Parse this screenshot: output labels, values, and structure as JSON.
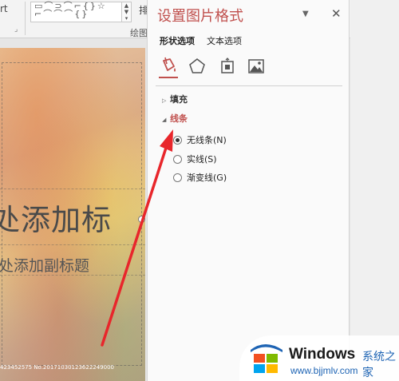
{
  "ribbon": {
    "left_fragment": "rt",
    "shape_row_1": "▭⌒⊃⌒⌐{}☆",
    "shape_row_2": "⌐⌒⌒⌒{}",
    "group_label": "绘图",
    "group_char": "排"
  },
  "slide": {
    "title": "处添加标",
    "subtitle": "处添加副标题",
    "watermark": "423452575 No.20171030123622249000"
  },
  "pane": {
    "title": "设置图片格式",
    "tabs": [
      "形状选项",
      "文本选项"
    ],
    "active_tab": "形状选项",
    "category_icons": [
      "fill-bucket-icon",
      "pentagon-effects-icon",
      "size-properties-icon",
      "picture-icon"
    ],
    "sections": {
      "fill": {
        "label": "填充",
        "expanded": false
      },
      "line": {
        "label": "线条",
        "expanded": true
      }
    },
    "line_options": [
      {
        "label": "无线条(N)",
        "checked": true
      },
      {
        "label": "实线(S)",
        "checked": false
      },
      {
        "label": "渐变线(G)",
        "checked": false
      }
    ],
    "accent_color": "#c0504d"
  },
  "watermark_badge": {
    "brand": "Windows",
    "brand_cn": "系统之家",
    "url": "www.bjjmlv.com",
    "logo_colors": [
      "#f25022",
      "#7fba00",
      "#00a4ef",
      "#ffb900"
    ]
  },
  "annotation": {
    "type": "red-arrow",
    "color": "#e8262b"
  }
}
